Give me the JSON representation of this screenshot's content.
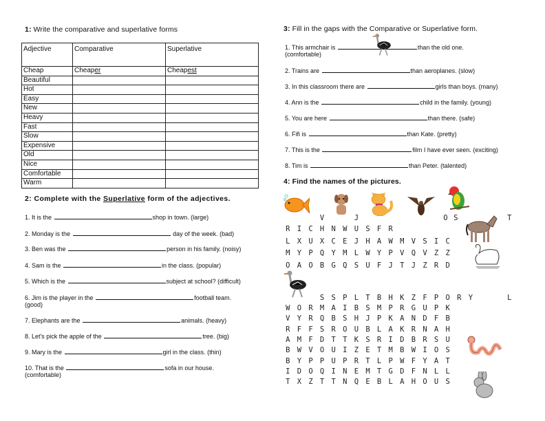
{
  "section1": {
    "title_num": "1:",
    "title_text": " Write the comparative and superlative forms",
    "headers": [
      "Adjective",
      "Comparative",
      "Superlative"
    ],
    "example": {
      "adjective": "Cheap",
      "comparative_base": "Cheap",
      "comparative_suffix": "er",
      "superlative_base": "Cheap",
      "superlative_suffix": "est"
    },
    "adjectives": [
      "Beautiful",
      "Hot",
      "Easy",
      "New",
      "Heavy",
      "Fast",
      "Slow",
      "Expensive",
      "Old",
      "Nice",
      "Comfortable",
      "Warm"
    ]
  },
  "section2": {
    "title_num": "2:",
    "title_pre": " Complete with the ",
    "title_underlined": "Superlative",
    "title_post": " form of the adjectives.",
    "items": [
      {
        "pre": "1. It is the",
        "post": "shop in town. (large)",
        "cont": ""
      },
      {
        "pre": "2. Monday is the",
        "post": " day of the week. (bad)",
        "cont": ""
      },
      {
        "pre": "3. Ben was the",
        "post": "person in his family. (noisy)",
        "cont": ""
      },
      {
        "pre": "4. Sam is the",
        "post": "in the class. (popular)",
        "cont": ""
      },
      {
        "pre": "5. Which is the",
        "post": "subject at school? (difficult)",
        "cont": ""
      },
      {
        "pre": "6. Jim is the player in the",
        "post": "football team.",
        "cont": "(good)"
      },
      {
        "pre": "7. Elephants are the",
        "post": "animals. (heavy)",
        "cont": ""
      },
      {
        "pre": "8. Let's pick the apple of the",
        "post": "tree. (big)",
        "cont": ""
      },
      {
        "pre": "9. Mary is the",
        "post": "girl in the class. (thin)",
        "cont": ""
      },
      {
        "pre": "10. That is the",
        "post": "sofa in our house.",
        "cont": "(comfortable)"
      }
    ]
  },
  "section3": {
    "title_num": "3:",
    "title_text": " Fill in the gaps with the Comparative or Superlative form.",
    "items": [
      {
        "pre": "1. This armchair is",
        "post": "than the old one.",
        "cont": "(comfortable)"
      },
      {
        "pre": "2. Trains are",
        "post": "than aeroplanes. (slow)",
        "cont": ""
      },
      {
        "pre": "3. In this classroom there are",
        "post": "girls than boys. (many)",
        "cont": ""
      },
      {
        "pre": "4. Ann is the",
        "post": "child in the family. (young)",
        "cont": ""
      },
      {
        "pre": "5. You are here",
        "post": "than there. (safe)",
        "cont": ""
      },
      {
        "pre": "6. Fifi is",
        "post": "than Kate. (pretty)",
        "cont": ""
      },
      {
        "pre": "7. This is the",
        "post": "film I have ever seen. (exciting)",
        "cont": ""
      },
      {
        "pre": "8. Tim is",
        "post": "than Peter. (talented)",
        "cont": ""
      }
    ]
  },
  "section4": {
    "title_num": "4:",
    "title_text": " Find the names of the pictures.",
    "pictures": [
      "fish",
      "dog",
      "cat",
      "eagle",
      "parrot",
      "horse",
      "swan",
      "ostrich",
      "worm",
      "rabbit"
    ],
    "grid_top": {
      "row0": [
        {
          "col": 3,
          "ch": "V"
        },
        {
          "col": 6,
          "ch": "J"
        },
        {
          "col": 13.8,
          "ch": "O"
        },
        {
          "col": 14.7,
          "ch": "S"
        },
        {
          "col": 19.4,
          "ch": "T"
        }
      ],
      "rows": [
        "RICHNWUSFR",
        "LXUXCEJHAWMVSIC",
        "MYPQYMLWYPVQVZZ",
        "OAOBGQSUFJTJZRD"
      ]
    },
    "grid_bottom": {
      "row0": "SSPLTBHKZFPORY",
      "row0_extra": "L",
      "rows": [
        "WORMAIBSMPRGUPK",
        "VYRQBSHJPKANDFB",
        "RFFSROUBLAKRNAH",
        "AMFDTTKSRIDBRSU",
        "BWVOUIZETMBWIOS",
        "BYPPUPRTLPWFYAT",
        "IDOQINEMTGDFNLL",
        "TXZTTNQEBLAHOUS"
      ]
    }
  }
}
